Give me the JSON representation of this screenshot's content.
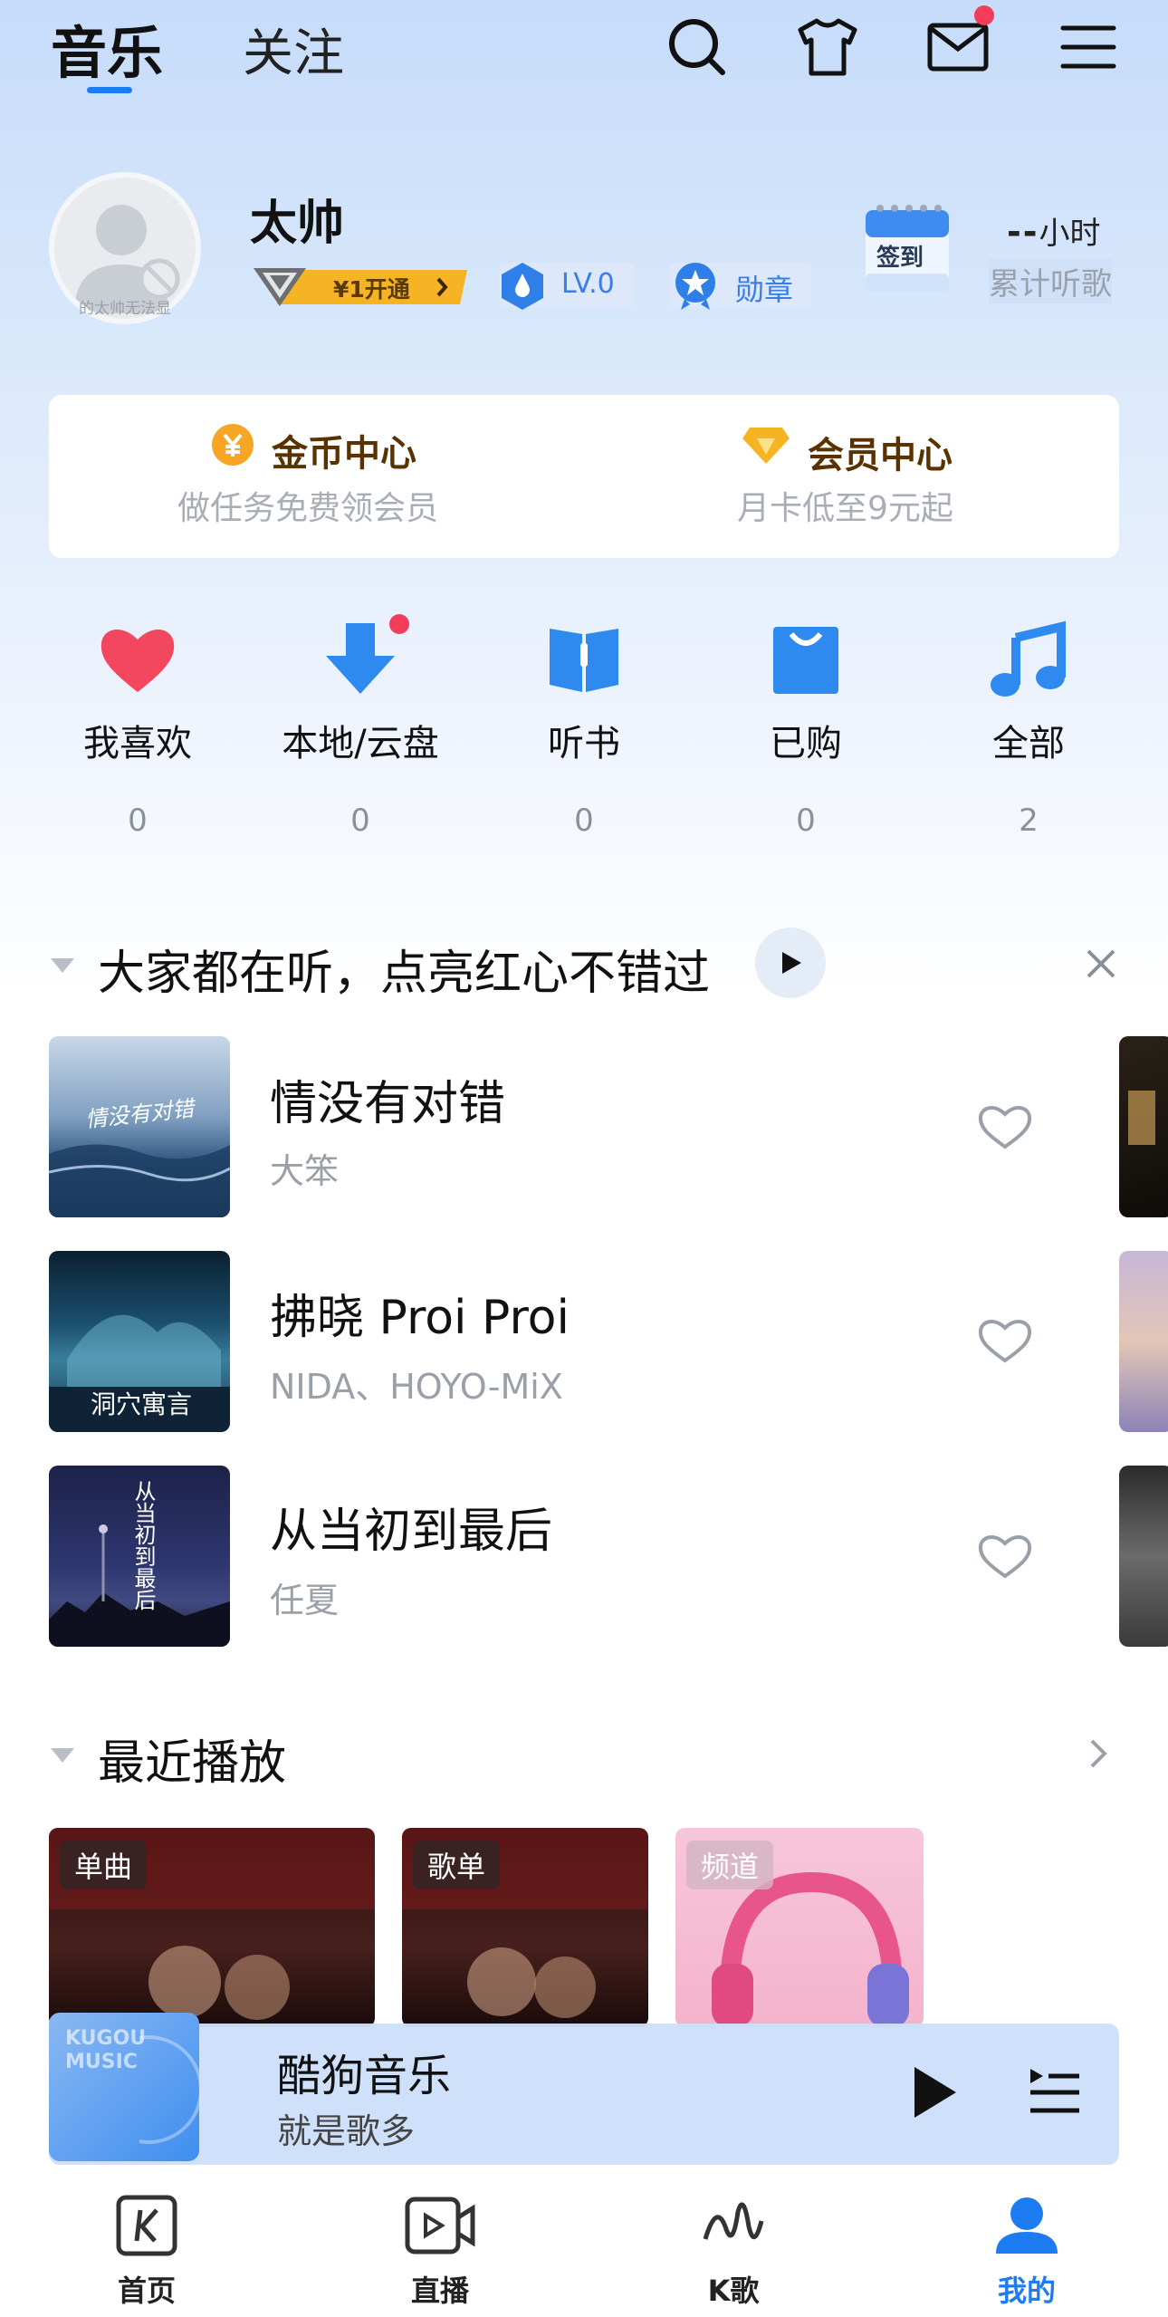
{
  "top_tabs": {
    "music": "音乐",
    "follow": "关注"
  },
  "top_icons": [
    "search-icon",
    "tshirt-icon",
    "mail-icon",
    "menu-icon"
  ],
  "profile": {
    "avatar_note": "的太帅无法显",
    "username": "太帅",
    "vip_label": "¥1开通",
    "level": "LV.0",
    "badge_label": "勋章",
    "checkin_label": "签到",
    "hours_value": "--",
    "hours_unit": "小时",
    "listen_label": "累计听歌"
  },
  "cards": {
    "coin": {
      "title": "金币中心",
      "subtitle": "做任务免费领会员"
    },
    "vip": {
      "title": "会员中心",
      "subtitle": "月卡低至9元起"
    }
  },
  "quick": [
    {
      "label": "我喜欢",
      "count": "0"
    },
    {
      "label": "本地/云盘",
      "count": "0"
    },
    {
      "label": "听书",
      "count": "0"
    },
    {
      "label": "已购",
      "count": "0"
    },
    {
      "label": "全部",
      "count": "2"
    }
  ],
  "recommend": {
    "title": "大家都在听，点亮红心不错过",
    "songs": [
      {
        "title": "情没有对错",
        "artist": "大笨",
        "cover_text": "情没有对错"
      },
      {
        "title": "拂晓 Proi Proi",
        "artist": "NIDA、HOYO-MiX",
        "cover_text": "洞穴寓言"
      },
      {
        "title": "从当初到最后",
        "artist": "任夏",
        "cover_text": "从当初到最后"
      }
    ]
  },
  "recent": {
    "title": "最近播放",
    "items": [
      {
        "tag": "单曲"
      },
      {
        "tag": "歌单"
      },
      {
        "tag": "频道"
      }
    ]
  },
  "player": {
    "title": "酷狗音乐",
    "subtitle": "就是歌多",
    "cover_text": "KUGOU MUSIC"
  },
  "bottom_nav": [
    {
      "label": "首页",
      "icon": "k-home-icon"
    },
    {
      "label": "直播",
      "icon": "live-icon"
    },
    {
      "label": "K歌",
      "icon": "karaoke-icon"
    },
    {
      "label": "我的",
      "icon": "profile-icon"
    }
  ],
  "colors": {
    "accent": "#1e7cf2",
    "red": "#f23d5a",
    "gold": "#f6b324"
  }
}
